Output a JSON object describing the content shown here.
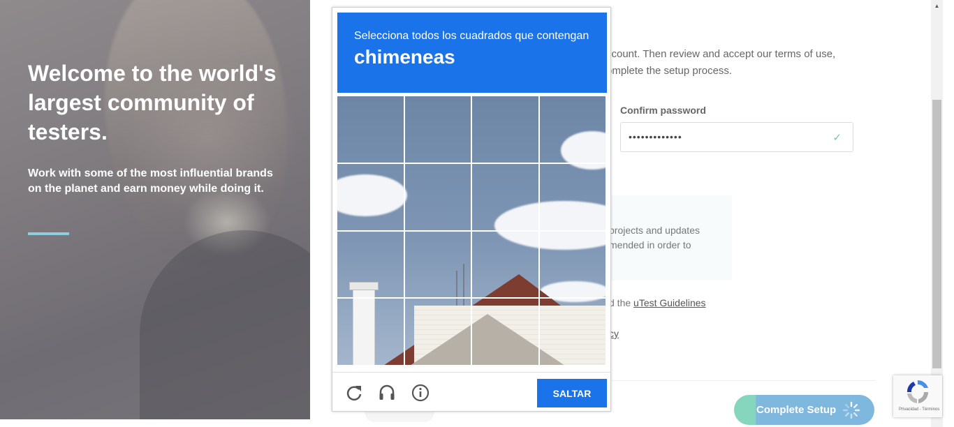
{
  "hero": {
    "title": "Welcome to the world's largest community of testers.",
    "subtitle": "Work with some of the most influential brands on the planet and earn money while doing it."
  },
  "form": {
    "intro_line1": "ccount. Then review and accept our terms of use,",
    "intro_line2": "omplete the setup process.",
    "confirm_password_label": "Confirm password",
    "confirm_password_value": "•••••••••••••",
    "info_line": "projects and updates",
    "info_line2": "mended in order to",
    "guidelines_prefix": "d the ",
    "guidelines_link": "uTest Guidelines",
    "policy_fragment": "cy",
    "complete_button": "Complete Setup"
  },
  "captcha": {
    "instruction": "Selecciona todos los cuadrados que contengan",
    "target": "chimeneas",
    "skip_label": "SALTAR",
    "icons": [
      "reload-icon",
      "audio-icon",
      "info-icon"
    ],
    "grid_rows": 4,
    "grid_cols": 4
  },
  "badge": {
    "links": "Privacidad - Términos"
  },
  "colors": {
    "captcha_blue": "#1a73e8",
    "accent_bar": "#8ccde0",
    "button_green": "#86d5bd",
    "button_blue": "#7fb8de"
  }
}
